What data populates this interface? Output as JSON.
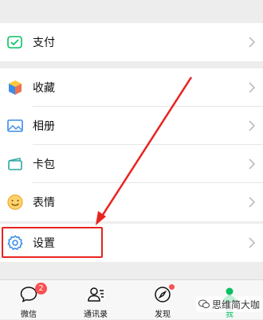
{
  "menu": {
    "pay": {
      "label": "支付",
      "icon": "wallet-pay-icon"
    },
    "favorites": {
      "label": "收藏",
      "icon": "cube-favorites-icon"
    },
    "album": {
      "label": "相册",
      "icon": "photo-album-icon"
    },
    "cards": {
      "label": "卡包",
      "icon": "card-wallet-icon"
    },
    "stickers": {
      "label": "表情",
      "icon": "smiley-icon"
    },
    "settings": {
      "label": "设置",
      "icon": "gear-icon"
    }
  },
  "tabbar": {
    "chats": {
      "label": "微信",
      "badge": "2",
      "icon": "chat-bubble-icon"
    },
    "contacts": {
      "label": "通讯录",
      "icon": "contacts-icon"
    },
    "discover": {
      "label": "发现",
      "icon": "compass-icon"
    },
    "me": {
      "label": "我",
      "icon": "person-icon",
      "active": true
    }
  },
  "annotation": {
    "color": "#e8241f",
    "target": "settings"
  },
  "watermark": {
    "text": "思维简大咖"
  },
  "colors": {
    "accent": "#07c160",
    "badge": "#fa5151",
    "background": "#ededed"
  }
}
